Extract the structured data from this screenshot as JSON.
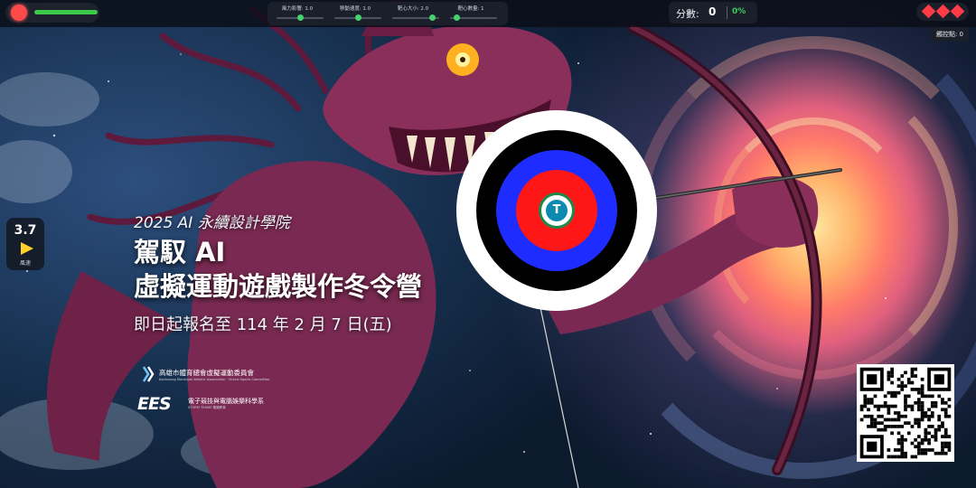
{
  "hud": {
    "health_fraction": 1.0,
    "sliders": [
      {
        "label": "風力影響: 1.0",
        "value": 0.5
      },
      {
        "label": "移動速度: 1.0",
        "value": 0.5
      },
      {
        "label": "靶心大小: 2.0",
        "value": 0.85
      },
      {
        "label": "靶心數量: 1",
        "value": 0.15
      }
    ],
    "score_label": "分數:",
    "score_value": "0",
    "accuracy": "0%",
    "lives": 3,
    "touch_label": "觸控點: 0"
  },
  "wind": {
    "value": "3.7",
    "label": "風速",
    "arrow_color": "#ffd02a"
  },
  "poster": {
    "subtitle": "2025 AI 永續設計學院",
    "title_line1": "駕馭 AI",
    "title_line2": "虛擬運動遊戲製作冬令營",
    "deadline": "即日起報名至 114 年 2 月 7 日(五)",
    "org1_name": "高雄市體育總會虛擬運動委員會",
    "org1_sub": "Kaohsiung Municipal Athletic Association · Virtual Sports Committee",
    "org2_logo": "EES",
    "org2_name": "電子競技與電腦娛樂科學系",
    "org2_sub": "STORM TEAMS 電競教育"
  },
  "target": {
    "logo_letter": "T",
    "ring_colors": [
      "#ffffff",
      "#000000",
      "#1e2cff",
      "#ff1616",
      "#ffffff"
    ]
  },
  "colors": {
    "health_dot": "#ff4a4a",
    "health_bar": "#3cc84a",
    "accent_green": "#3ecc5a",
    "life_red": "#ff3b45"
  },
  "icons": {
    "health": "health-dot-icon",
    "wind": "wind-direction-arrow-icon",
    "lives": "diamond-life-icon",
    "qr": "qr-code-icon"
  }
}
